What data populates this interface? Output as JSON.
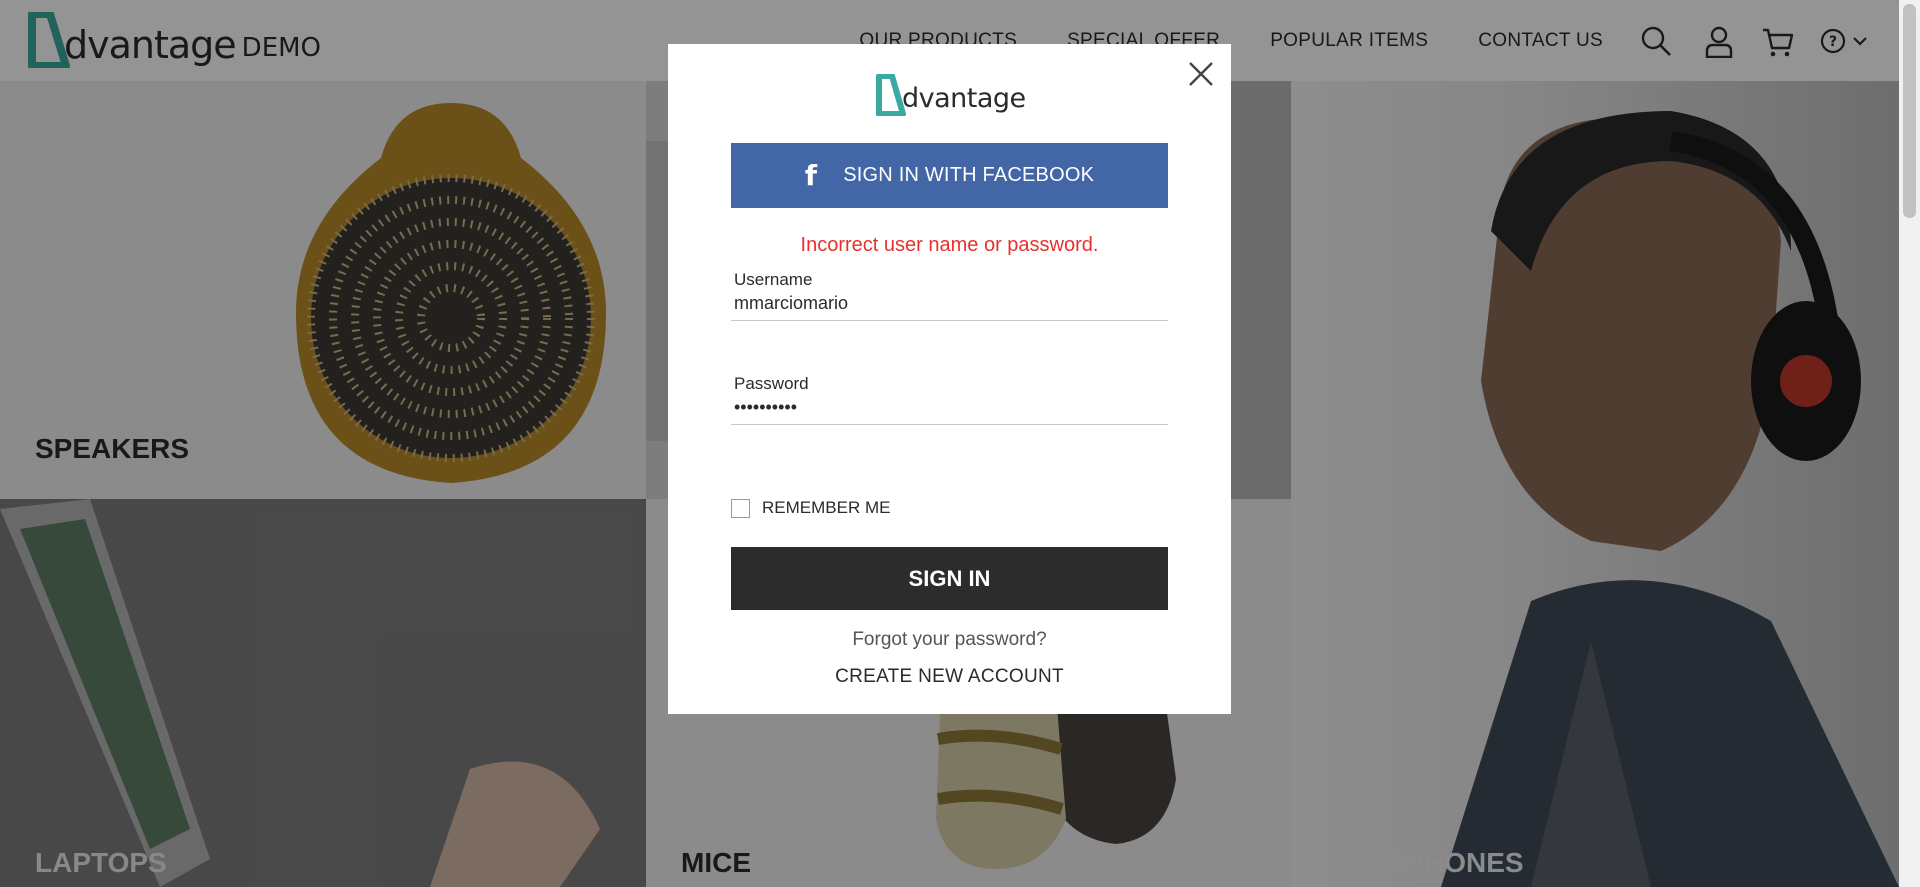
{
  "header": {
    "logo_word": "dvantage",
    "logo_demo": "DEMO",
    "nav": [
      "OUR PRODUCTS",
      "SPECIAL OFFER",
      "POPULAR ITEMS",
      "CONTACT US"
    ],
    "icons": [
      "search-icon",
      "user-icon",
      "cart-icon",
      "help-icon",
      "chevron-down-icon"
    ]
  },
  "categories": {
    "speakers": "SPEAKERS",
    "laptops": "LAPTOPS",
    "mice": "MICE",
    "headphones": "HEADPHONES"
  },
  "modal": {
    "logo_word": "dvantage",
    "facebook_icon": "f",
    "facebook_label": "SIGN IN WITH FACEBOOK",
    "error": "Incorrect user name or password.",
    "username_label": "Username",
    "username_value": "mmarciomario",
    "password_label": "Password",
    "password_value": "••••••••••",
    "remember_label": "REMEMBER ME",
    "signin_label": "SIGN IN",
    "forgot_label": "Forgot your password?",
    "create_label": "CREATE NEW ACCOUNT"
  },
  "colors": {
    "brand_teal": "#3aa9a0",
    "facebook_blue": "#4366a7",
    "error_red": "#e8312f",
    "signin_dark": "#2c2c2c"
  }
}
